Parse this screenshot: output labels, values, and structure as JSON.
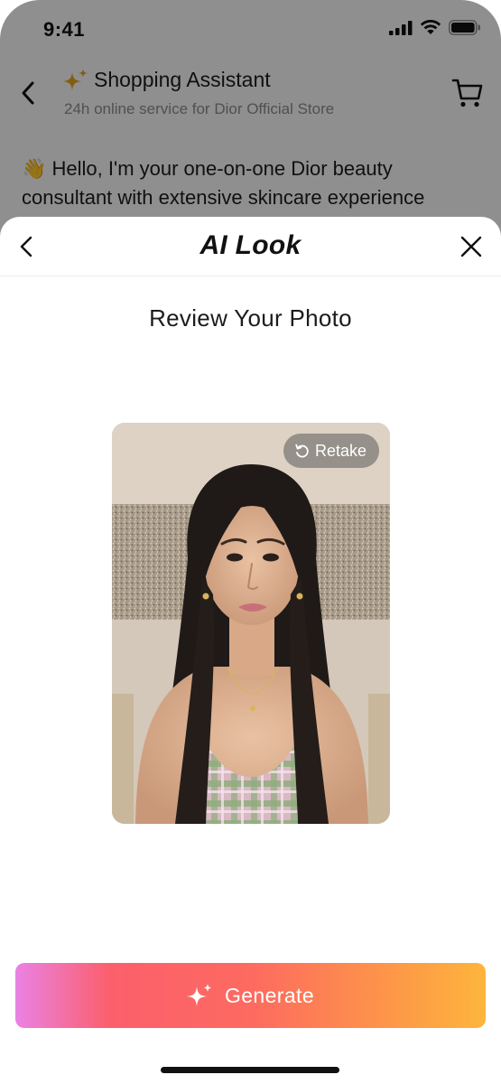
{
  "status_bar": {
    "time": "9:41"
  },
  "chat": {
    "title": "Shopping Assistant",
    "subtitle": "24h online service for Dior Official Store",
    "message_emoji": "👋",
    "message_text": "Hello, I'm your one-on-one Dior beauty consultant with extensive skincare experience"
  },
  "sheet": {
    "title": "AI Look",
    "heading": "Review Your Photo",
    "retake_label": "Retake",
    "generate_label": "Generate"
  },
  "colors": {
    "accent_gold": "#e0a31c",
    "gradient_start": "#ea82e4",
    "gradient_mid": "#fb5f6c",
    "gradient_end": "#fdb53c"
  },
  "icons": [
    "signal-icon",
    "wifi-icon",
    "battery-icon",
    "back-chevron-icon",
    "sparkle-icon",
    "cart-icon",
    "close-icon",
    "retake-icon",
    "generate-sparkle-icon"
  ]
}
